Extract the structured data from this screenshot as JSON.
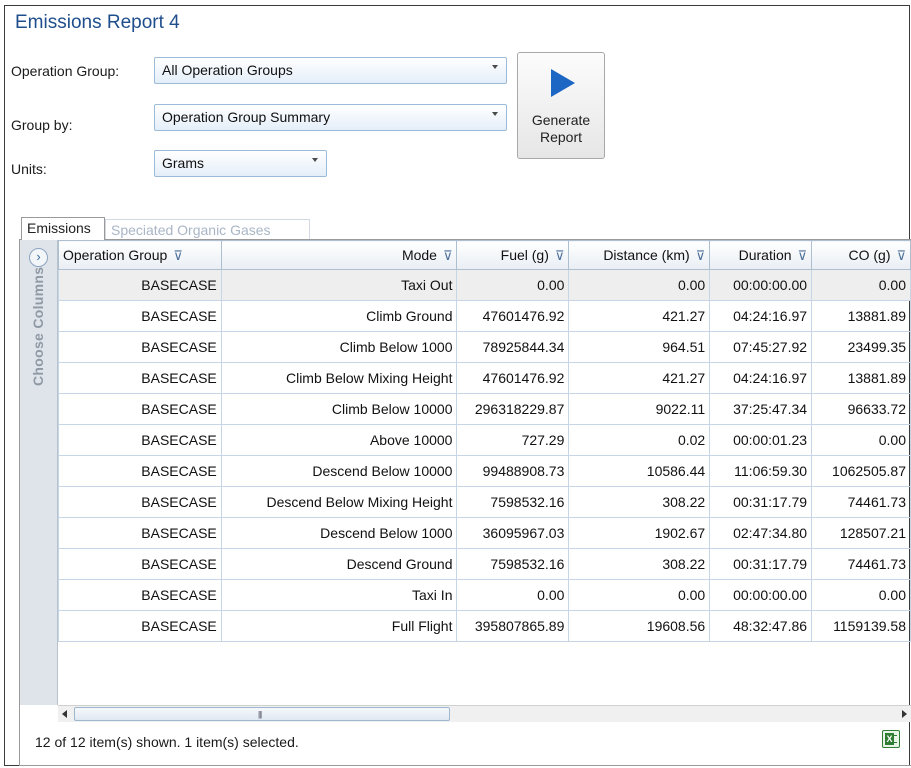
{
  "report": {
    "title": "Emissions Report 4"
  },
  "filters": {
    "operation_group_label": "Operation Group:",
    "operation_group_value": "All Operation Groups",
    "group_by_label": "Group by:",
    "group_by_value": "Operation Group Summary",
    "units_label": "Units:",
    "units_value": "Grams"
  },
  "generate_button": {
    "label": "Generate\nReport",
    "icon": "play-icon"
  },
  "tabs": [
    {
      "label": "Emissions",
      "active": true
    },
    {
      "label": "Speciated Organic Gases",
      "active": false
    }
  ],
  "sidebar": {
    "label": "Choose Columns",
    "icon": "chevron-right-circle-icon"
  },
  "grid": {
    "columns": [
      "Operation Group",
      "Mode",
      "Fuel (g)",
      "Distance (km)",
      "Duration",
      "CO (g)"
    ],
    "rows": [
      [
        "BASECASE",
        "Taxi Out",
        "0.00",
        "0.00",
        "00:00:00.00",
        "0.00"
      ],
      [
        "BASECASE",
        "Climb Ground",
        "47601476.92",
        "421.27",
        "04:24:16.97",
        "13881.89"
      ],
      [
        "BASECASE",
        "Climb Below 1000",
        "78925844.34",
        "964.51",
        "07:45:27.92",
        "23499.35"
      ],
      [
        "BASECASE",
        "Climb Below Mixing Height",
        "47601476.92",
        "421.27",
        "04:24:16.97",
        "13881.89"
      ],
      [
        "BASECASE",
        "Climb Below 10000",
        "296318229.87",
        "9022.11",
        "37:25:47.34",
        "96633.72"
      ],
      [
        "BASECASE",
        "Above 10000",
        "727.29",
        "0.02",
        "00:00:01.23",
        "0.00"
      ],
      [
        "BASECASE",
        "Descend Below 10000",
        "99488908.73",
        "10586.44",
        "11:06:59.30",
        "1062505.87"
      ],
      [
        "BASECASE",
        "Descend Below Mixing Height",
        "7598532.16",
        "308.22",
        "00:31:17.79",
        "74461.73"
      ],
      [
        "BASECASE",
        "Descend Below 1000",
        "36095967.03",
        "1902.67",
        "02:47:34.80",
        "128507.21"
      ],
      [
        "BASECASE",
        "Descend Ground",
        "7598532.16",
        "308.22",
        "00:31:17.79",
        "74461.73"
      ],
      [
        "BASECASE",
        "Taxi In",
        "0.00",
        "0.00",
        "00:00:00.00",
        "0.00"
      ],
      [
        "BASECASE",
        "Full Flight",
        "395807865.89",
        "19608.56",
        "48:32:47.86",
        "1159139.58"
      ]
    ],
    "selected_row_index": 0
  },
  "status": {
    "text": "12 of 12 item(s) shown. 1 item(s) selected."
  },
  "export": {
    "icon": "excel-export-icon"
  }
}
